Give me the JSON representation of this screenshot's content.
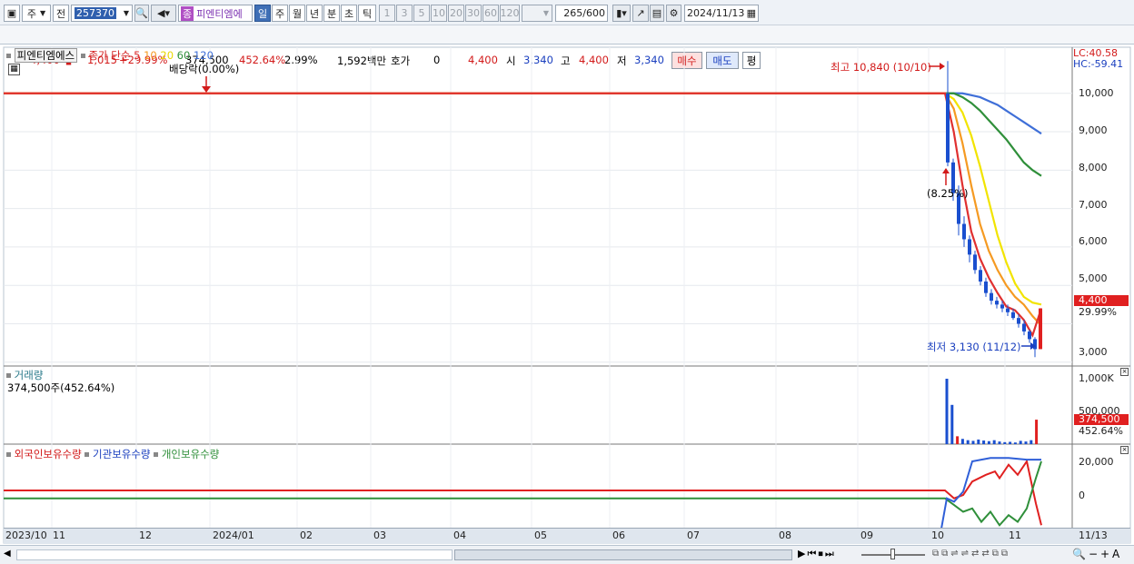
{
  "toolbar": {
    "period_d": "주",
    "prev": "전",
    "code": "257370",
    "name": "피엔티엠에",
    "name_badge": "종",
    "tabs": [
      "일",
      "주",
      "월",
      "년",
      "분",
      "초",
      "틱"
    ],
    "nums": [
      "1",
      "3",
      "5",
      "10",
      "20",
      "30",
      "60",
      "120"
    ],
    "count": "265",
    "total": "/600",
    "date": "2024/11/13"
  },
  "quote": {
    "price": "4,400",
    "change": "1,015",
    "pct": "+29.99%",
    "volume": "374,500",
    "vol_pct": "452.64%",
    "turnover": "2.99%",
    "amount": "1,592백만",
    "hoga_label": "호가",
    "hoga": "0",
    "p1": "4,400",
    "open_label": "시",
    "open": "3,340",
    "high_label": "고",
    "high": "4,400",
    "low_label": "저",
    "low": "3,340",
    "buy": "매수",
    "sell": "매도",
    "flat": "평"
  },
  "price_pane": {
    "name": "피엔티엠에스",
    "ma_label": "종가 단순",
    "ma": [
      "5",
      "10",
      "20",
      "60",
      "120"
    ],
    "ma_colors": [
      "#e03030",
      "#f59a22",
      "#f2e400",
      "#2f8f3a",
      "#3f6fd8"
    ],
    "dividend": "배당락(0.00%)",
    "high_note": "최고 10,840 (10/10)",
    "low_note": "최저 3,130 (11/12)",
    "mid_note": "(8.25%)",
    "lc": "LC:40.58",
    "hc": "HC:-59.41",
    "ticks": [
      "10,000",
      "9,000",
      "8,000",
      "7,000",
      "6,000",
      "5,000",
      "3,000"
    ],
    "cur": "4,400",
    "cur_pct": "29.99%"
  },
  "vol_pane": {
    "title": "거래량",
    "desc": "374,500주(452.64%)",
    "ticks": [
      "1,000K",
      "500,000"
    ],
    "cur": "374,500",
    "cur_pct": "452.64%"
  },
  "hold_pane": {
    "s1": "외국인보유수량",
    "s2": "기관보유수량",
    "s3": "개인보유수량",
    "ticks": [
      "20,000",
      "0"
    ]
  },
  "xaxis": [
    "2023/10",
    "11",
    "12",
    "2024/01",
    "02",
    "03",
    "04",
    "05",
    "06",
    "07",
    "08",
    "09",
    "10",
    "11",
    "11/13"
  ],
  "chart_data": {
    "type": "candlestick",
    "title": "피엔티엠에스",
    "period": "daily",
    "ylabel": "",
    "price_ylim": [
      2900,
      11200
    ],
    "ma": {
      "5": [
        10000,
        9000,
        7600,
        6400,
        5700,
        5200,
        4800,
        4450,
        4350,
        4100,
        3700,
        4400
      ],
      "10": [
        10000,
        9600,
        8700,
        7600,
        6600,
        5900,
        5400,
        5000,
        4700,
        4500,
        4200,
        3950
      ],
      "20": [
        10000,
        9850,
        9500,
        8900,
        8100,
        7200,
        6300,
        5600,
        5050,
        4700,
        4550,
        4500
      ],
      "60": [
        10000,
        10000,
        9900,
        9750,
        9550,
        9300,
        9050,
        8800,
        8500,
        8200,
        8000,
        7850
      ],
      "120": [
        10000,
        10000,
        10000,
        9950,
        9900,
        9800,
        9700,
        9550,
        9400,
        9250,
        9100,
        8950
      ]
    },
    "dividend_pct": "0.00%",
    "high": 10840,
    "low": 3130,
    "close": 4400
  }
}
